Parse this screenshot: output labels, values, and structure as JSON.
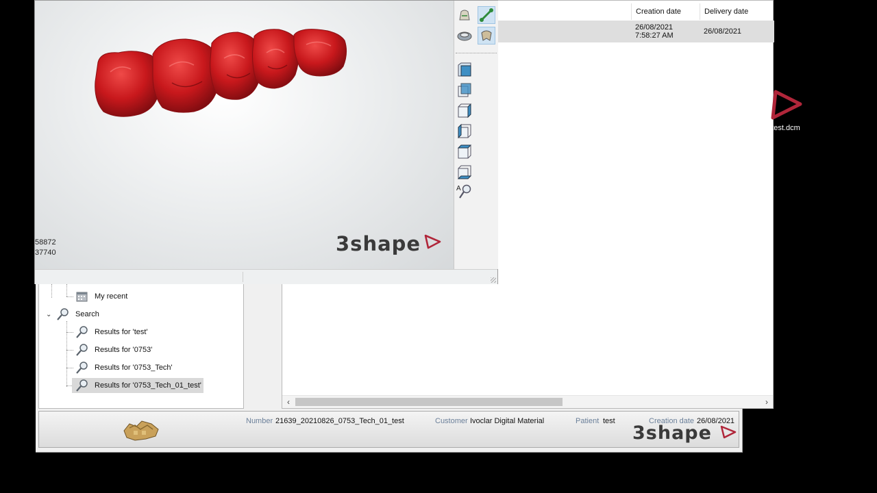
{
  "grid": {
    "columns": [
      "Creation date",
      "Delivery date"
    ],
    "row": {
      "creation_date": "26/08/2021",
      "creation_time": "7:58:27 AM",
      "delivery_date": "26/08/2021"
    }
  },
  "tree": {
    "items": [
      {
        "label": "My recent"
      },
      {
        "label": "Search"
      },
      {
        "label": "Results for 'test'"
      },
      {
        "label": "Results for '0753'"
      },
      {
        "label": "Results for '0753_Tech'"
      },
      {
        "label": "Results for '0753_Tech_01_test'"
      }
    ]
  },
  "info_bar": {
    "number_label": "Number",
    "number_value": "21639_20210826_0753_Tech_01_test",
    "customer_label": "Customer",
    "customer_value": "Ivoclar Digital Material",
    "patient_label": "Patient",
    "patient_value": "test",
    "creation_label": "Creation date",
    "creation_value": "26/08/2021",
    "brand": "3shape"
  },
  "viewer": {
    "brand": "3shape",
    "coord_1": "58872",
    "coord_2": "37740",
    "model_color": "#c8181c"
  },
  "desktop": {
    "file_label": "test.dcm",
    "accent": "#b0263a"
  }
}
